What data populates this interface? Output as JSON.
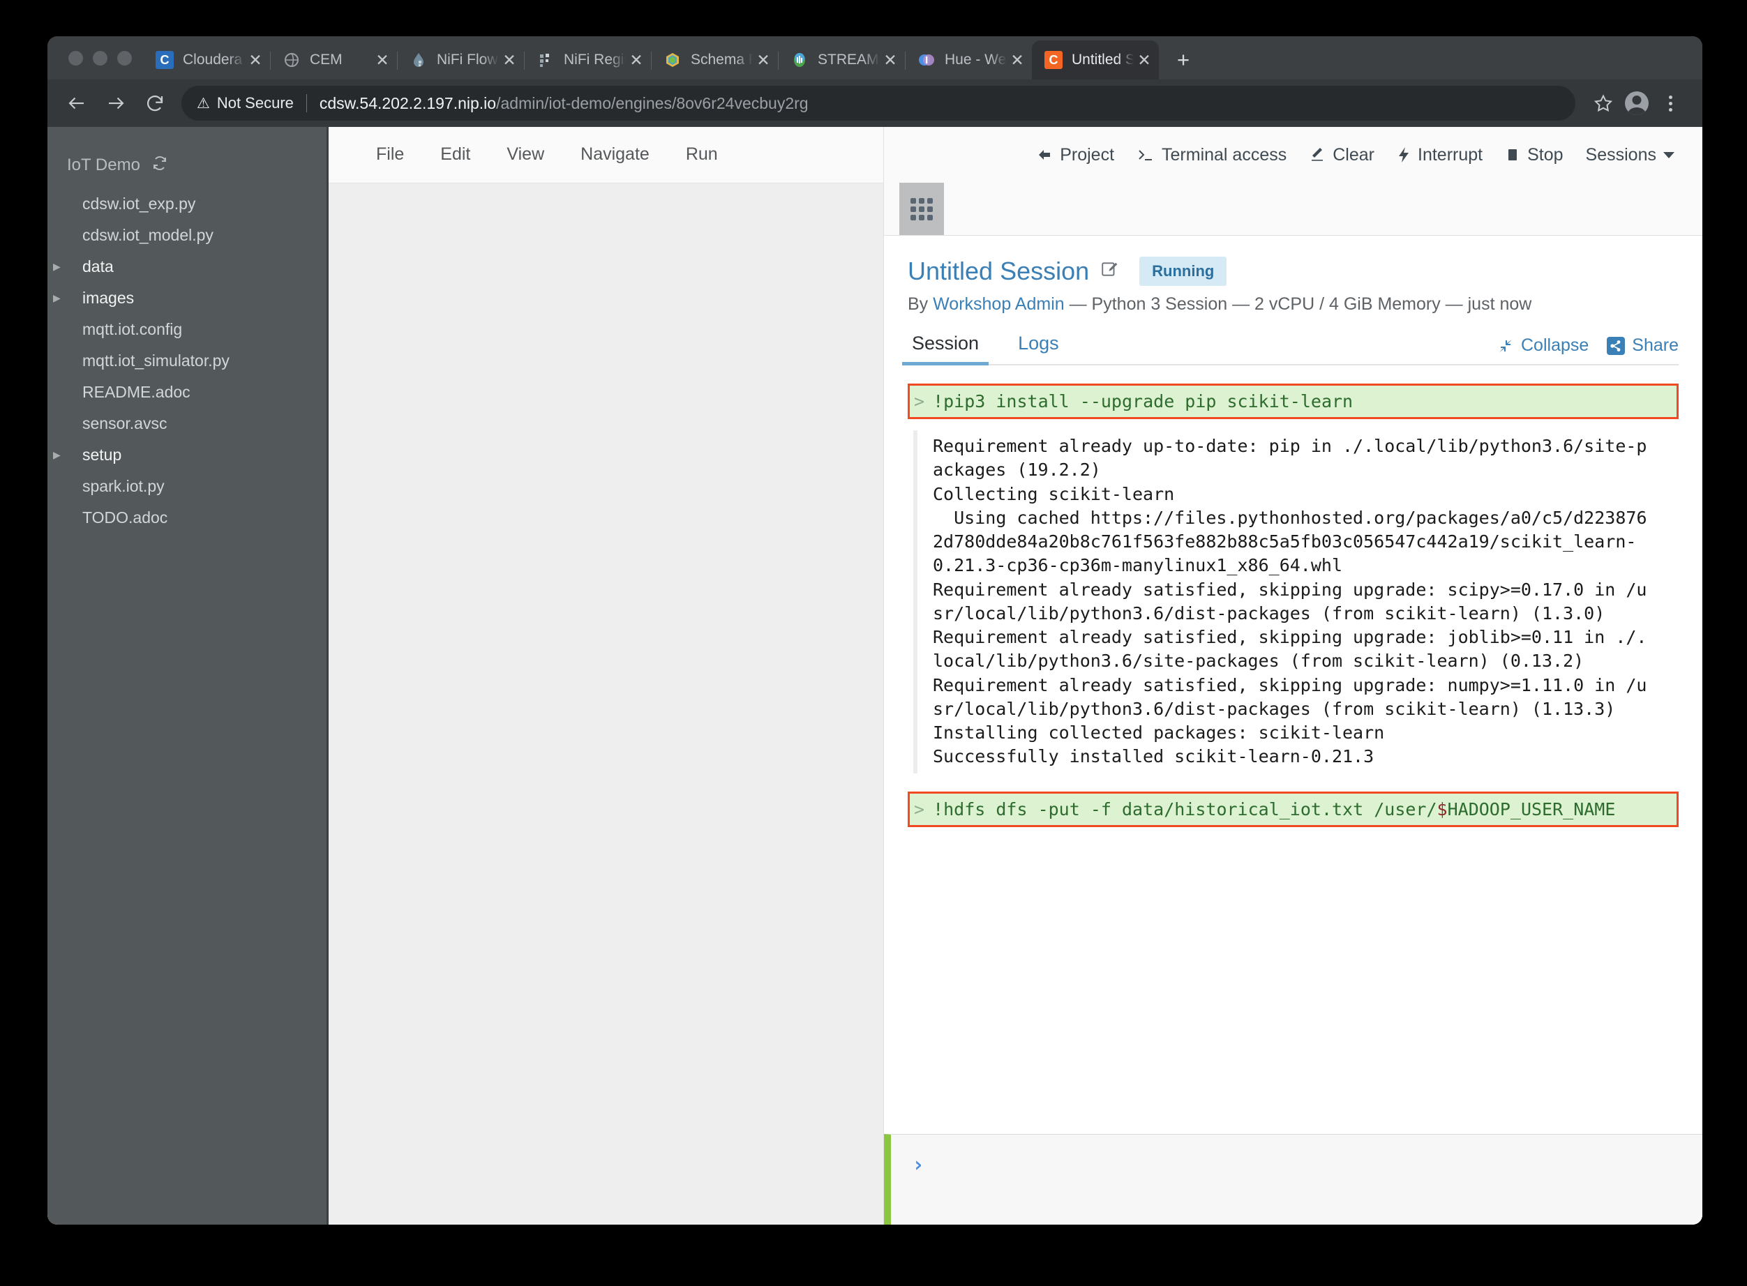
{
  "browser": {
    "tabs": [
      {
        "label": "Cloudera M",
        "icon": "cloudera-icon",
        "active": false
      },
      {
        "label": "CEM",
        "icon": "cem-icon",
        "active": false
      },
      {
        "label": "NiFi Flow",
        "icon": "nifi-icon",
        "active": false
      },
      {
        "label": "NiFi Registr",
        "icon": "nifi-registry-icon",
        "active": false
      },
      {
        "label": "Schema Re",
        "icon": "schema-registry-icon",
        "active": false
      },
      {
        "label": "STREAMS M",
        "icon": "streams-messaging-icon",
        "active": false
      },
      {
        "label": "Hue - Welc",
        "icon": "hue-icon",
        "active": false
      },
      {
        "label": "Untitled Se",
        "icon": "cdsw-icon",
        "active": true
      }
    ],
    "new_tab_label": "+",
    "close_label": "✕",
    "security_label": "Not Secure",
    "url_host": "cdsw.54.202.2.197.nip.io",
    "url_path": "/admin/iot-demo/engines/8ov6r24vecbuy2rg"
  },
  "sidebar": {
    "project_name": "IoT Demo",
    "refresh_icon": "refresh-icon",
    "items": [
      {
        "label": "cdsw.iot_exp.py",
        "type": "file"
      },
      {
        "label": "cdsw.iot_model.py",
        "type": "file"
      },
      {
        "label": "data",
        "type": "dir"
      },
      {
        "label": "images",
        "type": "dir"
      },
      {
        "label": "mqtt.iot.config",
        "type": "file"
      },
      {
        "label": "mqtt.iot_simulator.py",
        "type": "file"
      },
      {
        "label": "README.adoc",
        "type": "file"
      },
      {
        "label": "sensor.avsc",
        "type": "file"
      },
      {
        "label": "setup",
        "type": "dir"
      },
      {
        "label": "spark.iot.py",
        "type": "file"
      },
      {
        "label": "TODO.adoc",
        "type": "file"
      }
    ]
  },
  "editor": {
    "menu": [
      "File",
      "Edit",
      "View",
      "Navigate",
      "Run"
    ]
  },
  "console": {
    "toolbar": [
      {
        "label": "Project",
        "icon": "back-arrow-icon"
      },
      {
        "label": "Terminal access",
        "icon": "terminal-icon"
      },
      {
        "label": "Clear",
        "icon": "eraser-icon"
      },
      {
        "label": "Interrupt",
        "icon": "bolt-icon"
      },
      {
        "label": "Stop",
        "icon": "stop-square-icon"
      },
      {
        "label": "Sessions",
        "icon": "chevron-down-icon"
      }
    ],
    "grid_button_icon": "app-grid-icon",
    "session_title": "Untitled Session",
    "edit_icon": "edit-pencil-icon",
    "status_badge": "Running",
    "meta_prefix": "By",
    "author": "Workshop Admin",
    "meta_suffix": "— Python 3 Session — 2 vCPU / 4 GiB Memory — just now",
    "tabs": [
      {
        "label": "Session",
        "active": true
      },
      {
        "label": "Logs",
        "active": false
      }
    ],
    "collapse_label": "Collapse",
    "collapse_icon": "collapse-arrows-icon",
    "share_label": "Share",
    "share_icon": "share-icon",
    "cells": [
      {
        "prompt": ">",
        "command_pre": "!pip3 install --upgrade pip scikit-learn",
        "command_dollar": "",
        "command_post": "",
        "highlighted": true,
        "output": "Requirement already up-to-date: pip in ./.local/lib/python3.6/site-p\nackages (19.2.2)\nCollecting scikit-learn\n  Using cached https://files.pythonhosted.org/packages/a0/c5/d223876\n2d780dde84a20b8c761f563fe882b88c5a5fb03c056547c442a19/scikit_learn-\n0.21.3-cp36-cp36m-manylinux1_x86_64.whl\nRequirement already satisfied, skipping upgrade: scipy>=0.17.0 in /u\nsr/local/lib/python3.6/dist-packages (from scikit-learn) (1.3.0)\nRequirement already satisfied, skipping upgrade: joblib>=0.11 in ./.\nlocal/lib/python3.6/site-packages (from scikit-learn) (0.13.2)\nRequirement already satisfied, skipping upgrade: numpy>=1.11.0 in /u\nsr/local/lib/python3.6/dist-packages (from scikit-learn) (1.13.3)\nInstalling collected packages: scikit-learn\nSuccessfully installed scikit-learn-0.21.3"
      },
      {
        "prompt": ">",
        "command_pre": "!hdfs dfs -put -f data/historical_iot.txt /user/",
        "command_dollar": "$",
        "command_post": "HADOOP_USER_NAME",
        "highlighted": true,
        "output": ""
      }
    ],
    "input_prompt": "›"
  },
  "colors": {
    "accent_blue": "#3a7fb5",
    "highlight_border": "#f04a23",
    "command_bg": "#ddf2d1",
    "badge_bg": "#d6eaf6",
    "prompt_green": "#8ac63f"
  }
}
